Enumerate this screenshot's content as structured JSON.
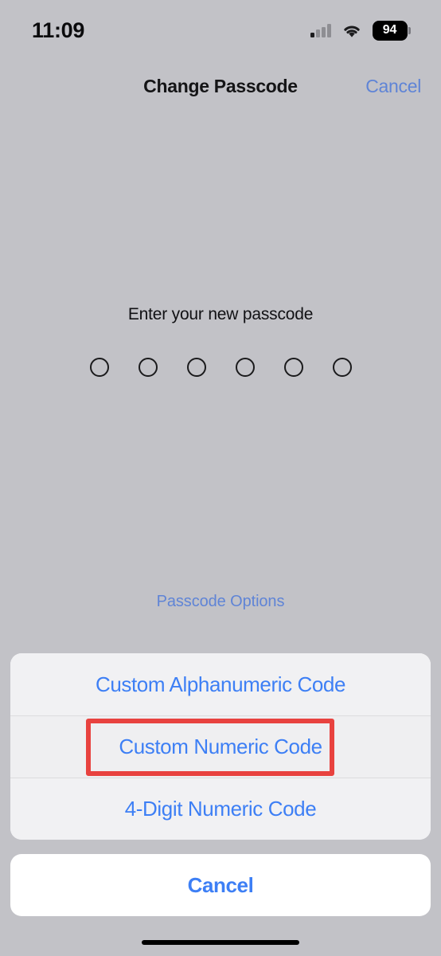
{
  "meta": {
    "platform": "iOS",
    "screen": "Change Passcode",
    "colors": {
      "background": "#c2c2c7",
      "sheet_background": "#f1f1f3",
      "cancel_background": "#ffffff",
      "accent_blue": "#3d7ff5",
      "muted_blue": "#5f84d6",
      "highlight_red": "#e8423f",
      "text_dark": "#141416"
    }
  },
  "status_bar": {
    "time": "11:09",
    "cellular_icon": "cellular-bars-icon",
    "cellular_bars_active": 1,
    "cellular_bars_total": 4,
    "wifi_icon": "wifi-icon",
    "battery_icon": "battery-icon",
    "battery_level": "94"
  },
  "nav_bar": {
    "title": "Change Passcode",
    "cancel_label": "Cancel"
  },
  "passcode": {
    "prompt": "Enter your new passcode",
    "dot_count": 6,
    "dots_filled": 0,
    "options_link_label": "Passcode Options"
  },
  "action_sheet": {
    "options": [
      {
        "label": "Custom Alphanumeric Code",
        "name": "custom-alphanumeric"
      },
      {
        "label": "Custom Numeric Code",
        "name": "custom-numeric",
        "highlighted": true
      },
      {
        "label": "4-Digit Numeric Code",
        "name": "four-digit-numeric"
      }
    ],
    "cancel_label": "Cancel"
  },
  "home_indicator": "home-indicator"
}
